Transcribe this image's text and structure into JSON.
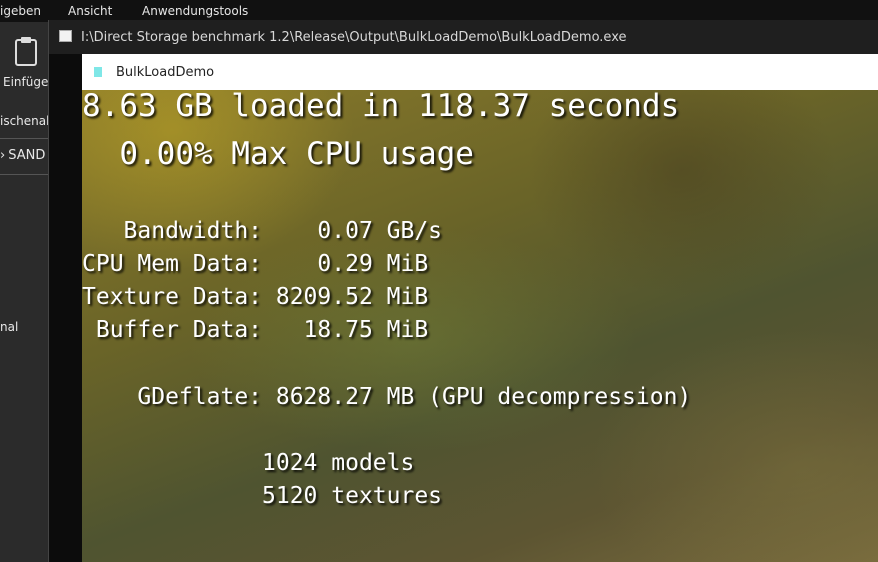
{
  "explorer": {
    "menu": [
      "igeben",
      "Ansicht",
      "Anwendungstools"
    ],
    "left_labels": {
      "paste": "Einfügen",
      "clipboard": "ischenabl",
      "drive": "SAND",
      "folder": "nal"
    }
  },
  "console": {
    "title": "I:\\Direct Storage benchmark 1.2\\Release\\Output\\BulkLoadDemo\\BulkLoadDemo.exe"
  },
  "app": {
    "title": "BulkLoadDemo",
    "stats": {
      "headline": "8.63 GB loaded in 118.37 seconds",
      "cpu": "  0.00% Max CPU usage",
      "bandwidth": "   Bandwidth:    0.07 GB/s",
      "cpu_mem": "CPU Mem Data:    0.29 MiB",
      "texture": "Texture Data: 8209.52 MiB",
      "buffer": " Buffer Data:   18.75 MiB",
      "gdeflate": "    GDeflate: 8628.27 MB (GPU decompression)",
      "models": "             1024 models",
      "textures": "             5120 textures"
    }
  },
  "colors": {
    "accent_icon": "#7fe7e7",
    "cursor": "#17c8a8"
  }
}
